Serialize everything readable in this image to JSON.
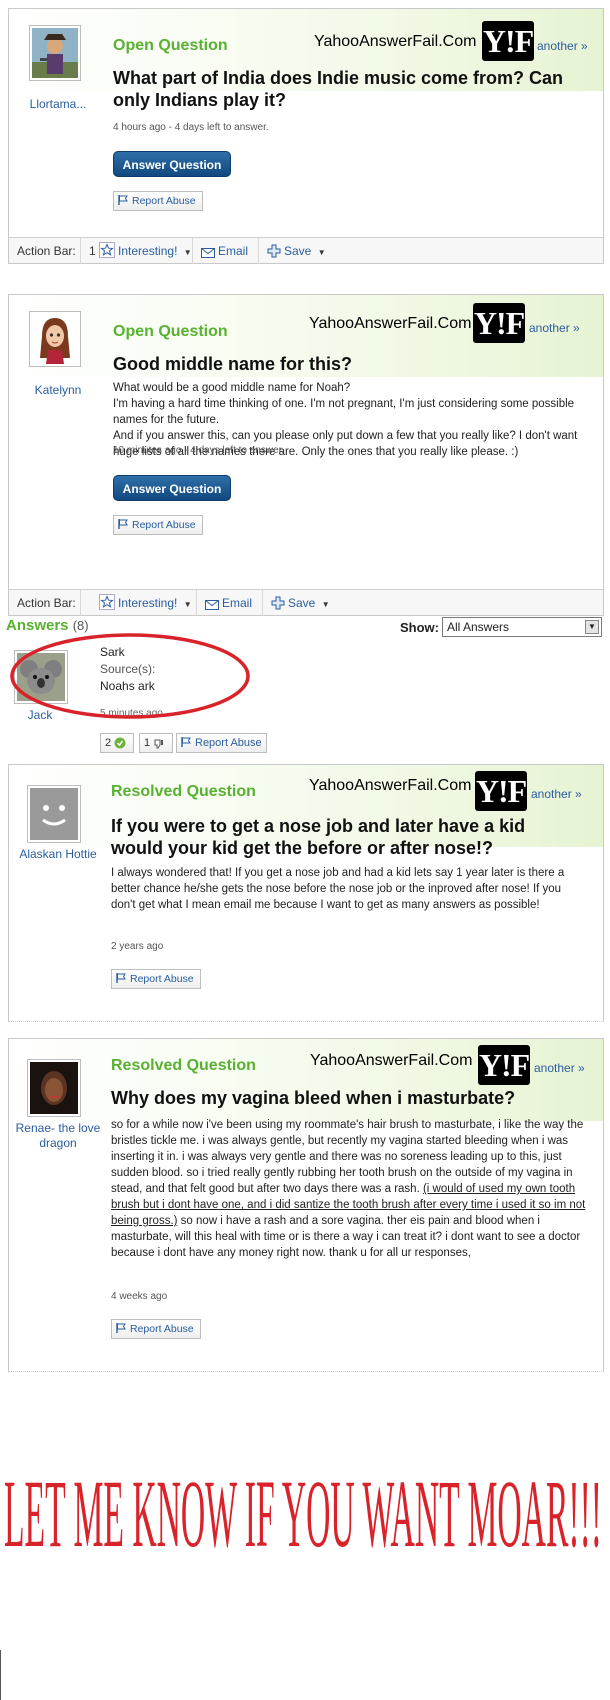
{
  "watermark": {
    "site": "YahooAnswerFail.Com",
    "logo": "Y!F",
    "another": "another »"
  },
  "q1": {
    "author": "Llortama...",
    "type": "Open Question",
    "title": "What part of India does Indie music come from? Can only Indians play it?",
    "meta": "4 hours ago - 4 days left to answer.",
    "answer_btn": "Answer Question",
    "report": "Report Abuse",
    "actionbar": {
      "label": "Action Bar:",
      "count": "1",
      "interesting": "Interesting!",
      "email": "Email",
      "save": "Save"
    }
  },
  "q2": {
    "author": "Katelynn",
    "type": "Open Question",
    "title": "Good middle name for this?",
    "body": [
      "What would be a good middle name for Noah?",
      "I'm having a hard time thinking of one. I'm not pregnant, I'm just considering some possible names for the future.",
      "And if you answer this, can you please only put down a few that you really like? I don't want huge lists of all the names there are. Only the ones that you really like please. :)"
    ],
    "meta": "10 minutes ago - 4 days left to answer.",
    "answer_btn": "Answer Question",
    "report": "Report Abuse",
    "actionbar": {
      "label": "Action Bar:",
      "interesting": "Interesting!",
      "email": "Email",
      "save": "Save"
    }
  },
  "answers": {
    "heading": "Answers",
    "count": "(8)",
    "show_label": "Show:",
    "show_value": "All Answers",
    "item": {
      "author": "Jack",
      "text": "Sark",
      "source_label": "Source(s):",
      "source": "Noahs ark",
      "time": "5 minutes ago",
      "thumbs_up": "2",
      "thumbs_down": "1",
      "report": "Report Abuse"
    },
    "highlight_color": "#d8232a"
  },
  "q3": {
    "author": "Alaskan Hottie",
    "type": "Resolved Question",
    "title": "If you were to get a nose job and later have a kid would your kid get the before or after nose!?",
    "body": "I always wondered that! If you get a nose job and had a kid lets say 1 year later is there a better chance he/she gets the nose before the nose job or the inproved after nose! If you don't get what I mean email me because I want to get as many answers as possible!",
    "meta": "2 years ago",
    "report": "Report Abuse"
  },
  "q4": {
    "author": "Renae- the love dragon",
    "type": "Resolved Question",
    "title": "Why does my vagina bleed when i masturbate?",
    "body_before": "so for a while now i've been using my roommate's hair brush to masturbate, i like the way the bristles tickle me. i was always gentle, but recently my vagina started bleeding when i was inserting it in. i was always very gentle and there was no soreness leading up to this, just sudden blood. so i tried really gently rubbing her tooth brush on the outside of my vagina in stead, and that felt good but after two days there was a rash. ",
    "body_underlined": "(i would of used my own tooth brush but i dont have one, and i did santize the tooth brush after every time i used it so im not being gross.)",
    "body_after": " so now i have a rash and a sore vagina. ther eis pain and blood when i masturbate, will this heal with time or is there a way i can treat it? i dont want to see a doctor because i dont have any money right now. thank u for all ur responses,",
    "meta": "4 weeks ago",
    "report": "Report Abuse"
  },
  "footer_text": "LET ME KNOW IF YOU WANT MOAR!!!",
  "colors": {
    "green": "#58b130",
    "link": "#2a5d9f",
    "red": "#d8232a",
    "button": "#1d5a93"
  }
}
